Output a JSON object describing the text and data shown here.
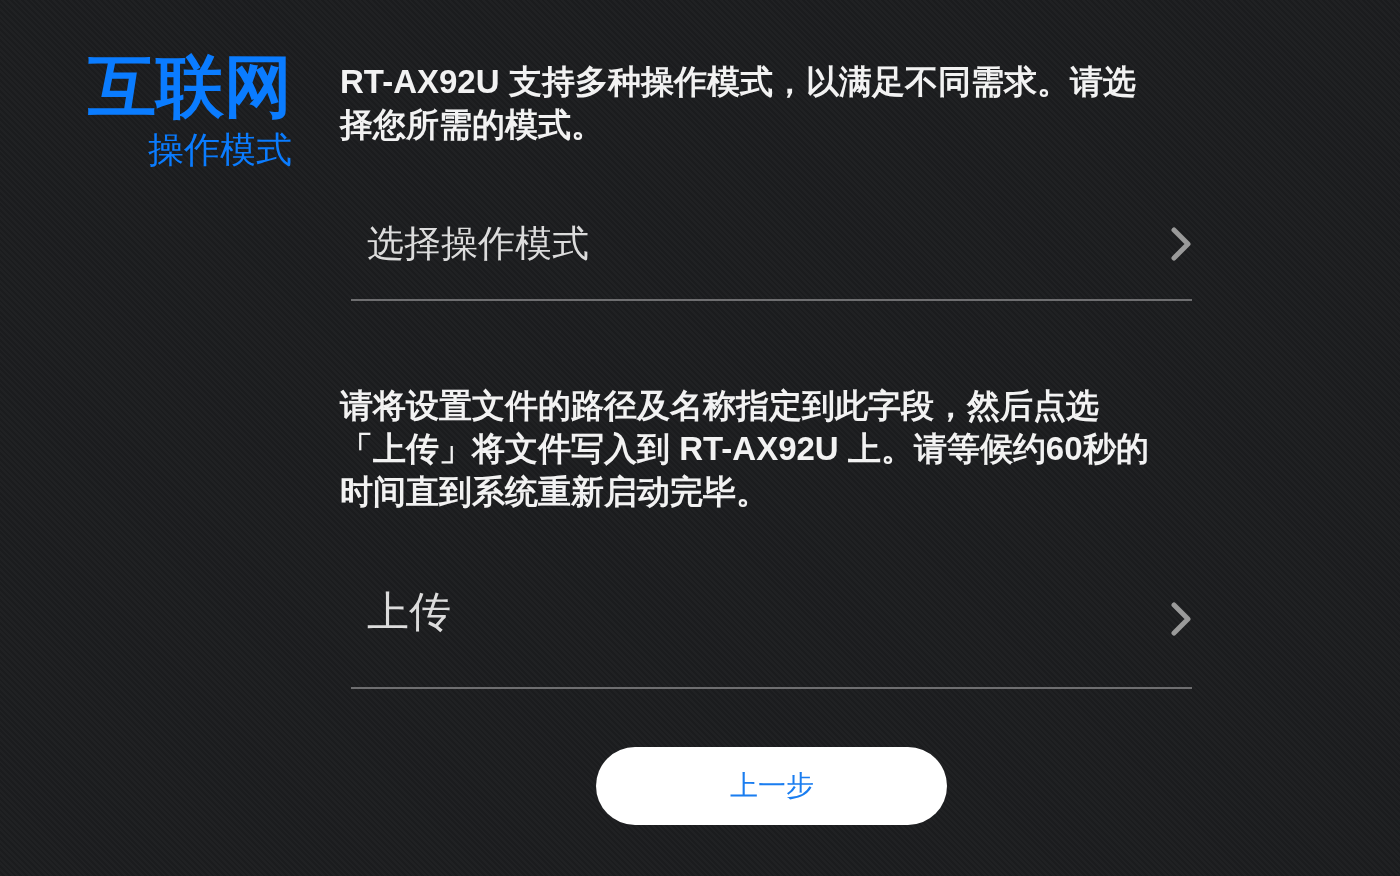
{
  "header": {
    "title": "互联网",
    "subtitle": "操作模式"
  },
  "sections": [
    {
      "description": "RT-AX92U 支持多种操作模式，以满足不同需求。请选择您所需的模式。",
      "action": {
        "label": "选择操作模式",
        "kind": "select"
      }
    },
    {
      "description": "请将设置文件的路径及名称指定到此字段，然后点选「上传」将文件写入到 RT-AX92U 上。请等候约60秒的时间直到系统重新启动完毕。",
      "action": {
        "label": "上传",
        "kind": "upload"
      }
    }
  ],
  "back_button": {
    "label": "上一步"
  }
}
